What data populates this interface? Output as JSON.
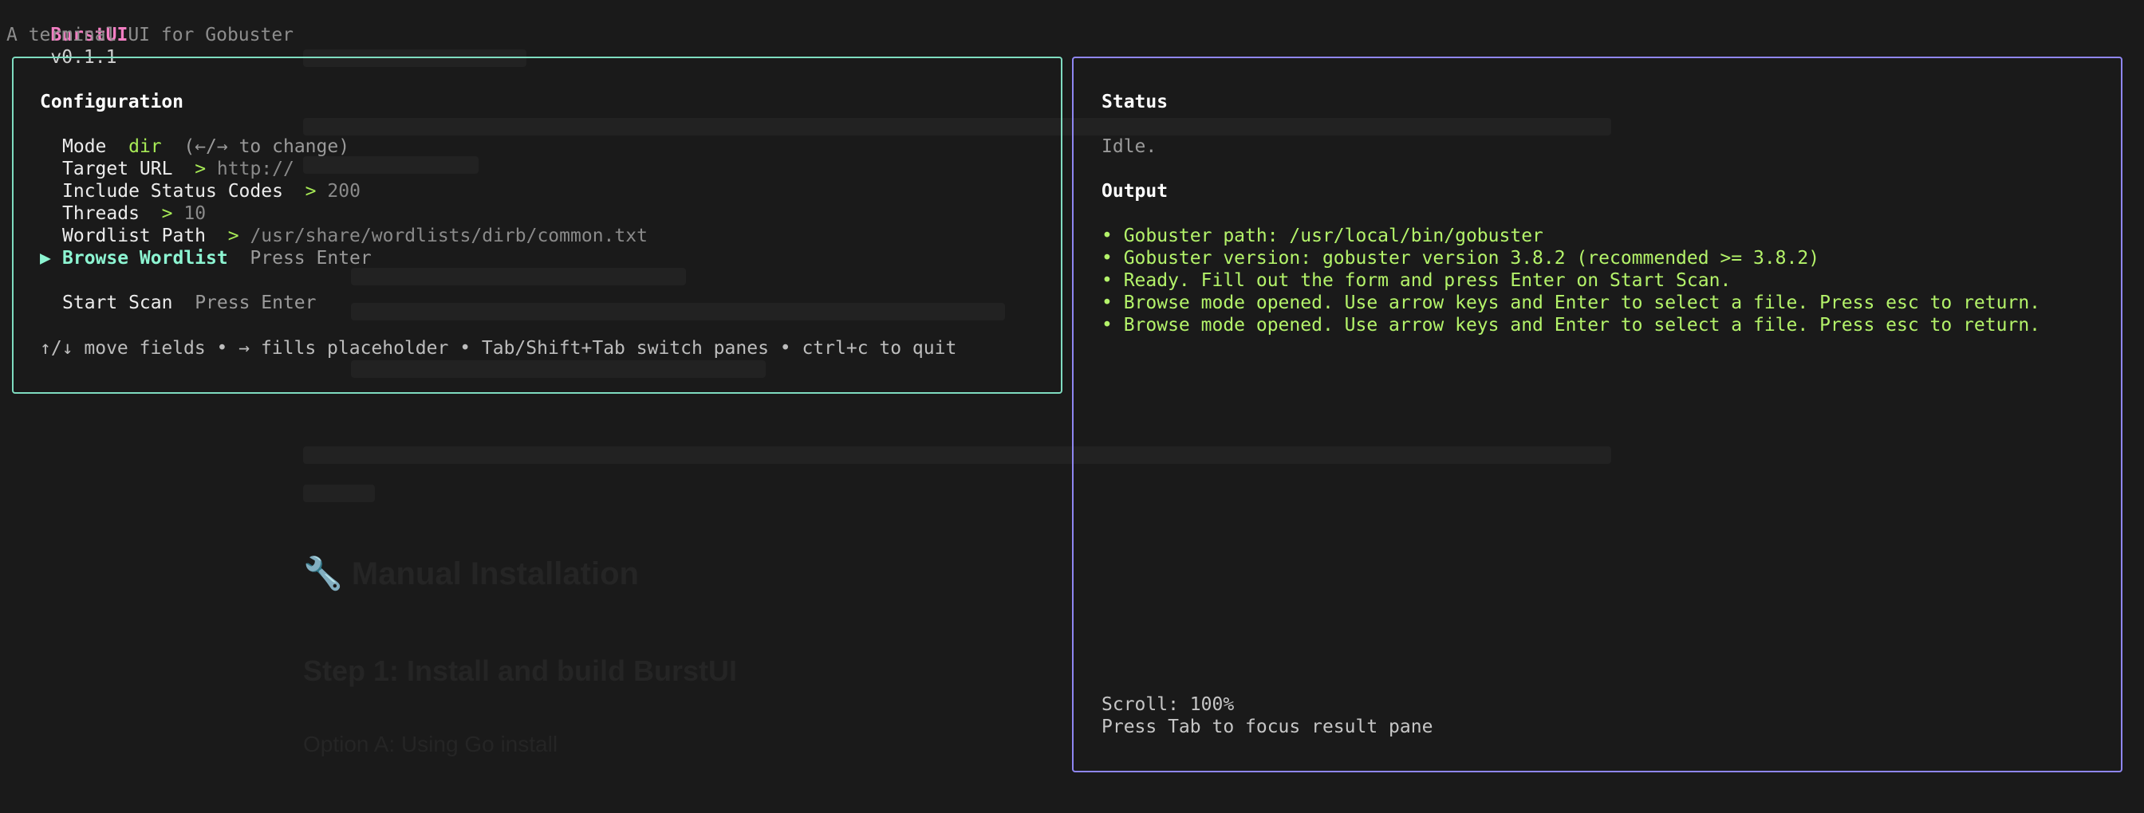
{
  "header": {
    "app_name": "BurstUI",
    "version": "v0.1.1",
    "tagline": "A terminal UI for Gobuster"
  },
  "config": {
    "title": "Configuration",
    "fields": {
      "mode": {
        "label": "Mode",
        "value": "dir",
        "hint": "(←/→ to change)"
      },
      "target_url": {
        "label": "Target URL",
        "prompt": ">",
        "value": "http://"
      },
      "status_codes": {
        "label": "Include Status Codes",
        "prompt": ">",
        "value": "200"
      },
      "threads": {
        "label": "Threads",
        "prompt": ">",
        "value": "10"
      },
      "wordlist_path": {
        "label": "Wordlist Path",
        "prompt": ">",
        "value": "/usr/share/wordlists/dirb/common.txt"
      },
      "browse_wordlist": {
        "cursor": "▶",
        "label": "Browse Wordlist",
        "hint": "Press Enter"
      },
      "start_scan": {
        "label": "Start Scan",
        "hint": "Press Enter"
      }
    },
    "help": "↑/↓ move fields • → fills placeholder • Tab/Shift+Tab switch panes • ctrl+c to quit"
  },
  "status": {
    "title": "Status",
    "state": "Idle.",
    "output_title": "Output",
    "output_lines": [
      "• Gobuster path: /usr/local/bin/gobuster",
      "• Gobuster version: gobuster version 3.8.2 (recommended >= 3.8.2)",
      "• Ready. Fill out the form and press Enter on Start Scan.",
      "• Browse mode opened. Use arrow keys and Enter to select a file. Press esc to return.",
      "• Browse mode opened. Use arrow keys and Enter to select a file. Press esc to return."
    ],
    "scroll": "Scroll: 100%",
    "tab_hint": "Press Tab to focus result pane"
  },
  "background_doc": {
    "heading_manual": "🔧 Manual Installation",
    "heading_step": "Step 1: Install and build BurstUI",
    "subheading": "Option A: Using Go install"
  },
  "colors": {
    "background": "#1a1a1a",
    "config_border": "#7fdcc0",
    "status_border": "#8f86f2",
    "app_name": "#f27ec2",
    "accent_green": "#a7ea56",
    "output_green": "#b4f36a",
    "active_field": "#8df5d2"
  }
}
